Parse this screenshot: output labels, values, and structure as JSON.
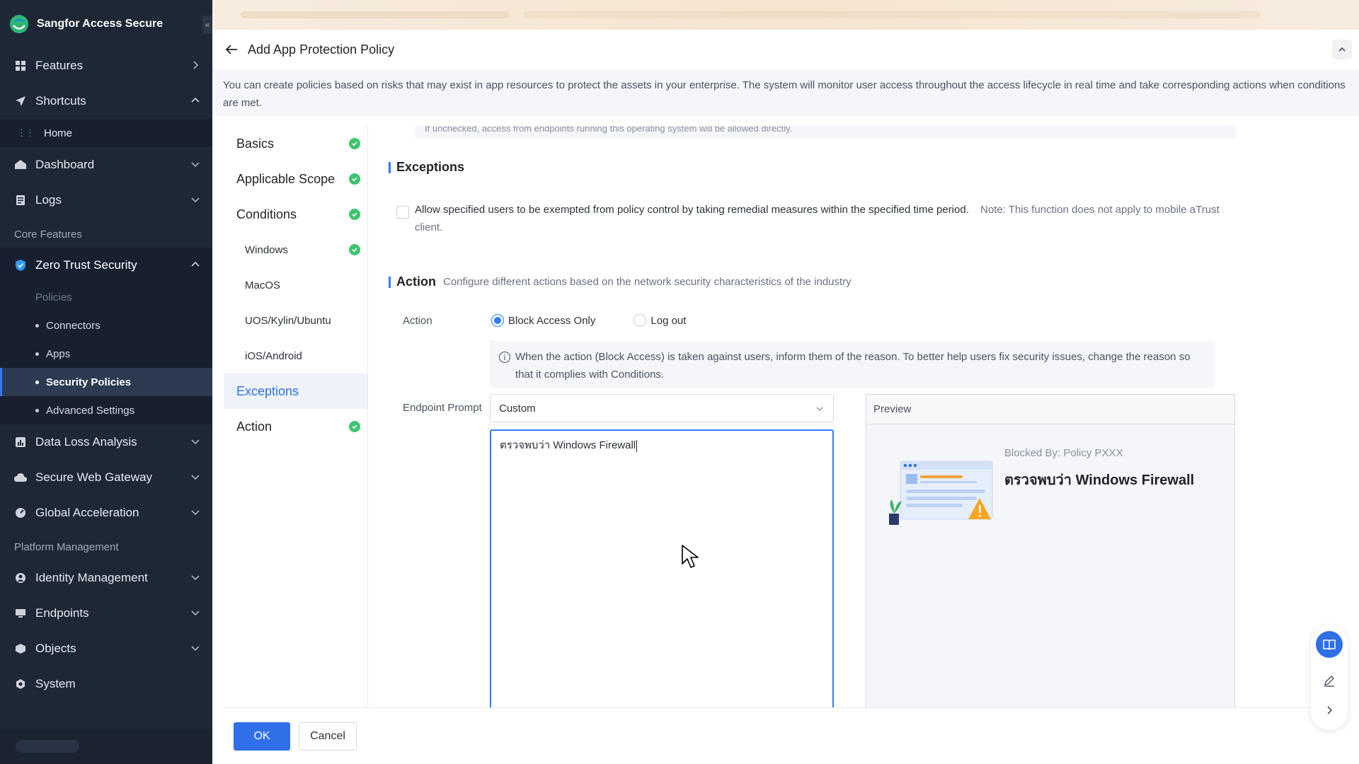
{
  "app": {
    "name": "Sangfor Access Secure"
  },
  "sidebar": {
    "features": "Features",
    "shortcuts": "Shortcuts",
    "home": "Home",
    "dashboard": "Dashboard",
    "logs": "Logs",
    "core_features_label": "Core Features",
    "zero_trust": "Zero Trust Security",
    "policies_label": "Policies",
    "sub_items": [
      "Connectors",
      "Apps",
      "Security Policies",
      "Advanced Settings"
    ],
    "data_loss": "Data Loss Analysis",
    "secure_web": "Secure Web Gateway",
    "global_accel": "Global Acceleration",
    "platform_label": "Platform Management",
    "identity": "Identity Management",
    "endpoints": "Endpoints",
    "objects": "Objects",
    "system": "System"
  },
  "page": {
    "title": "Add App Protection Policy",
    "description": "You can create policies based on risks that may exist in app resources to protect the assets in your enterprise. The system will monitor user access throughout the access lifecycle in real time and take corresponding actions when conditions are met."
  },
  "steps": {
    "basics": "Basics",
    "scope": "Applicable Scope",
    "conditions": "Conditions",
    "windows": "Windows",
    "macos": "MacOS",
    "uos": "UOS/Kylin/Ubuntu",
    "ios": "iOS/Android",
    "exceptions": "Exceptions",
    "action": "Action"
  },
  "form": {
    "truncated_note": "If unchecked, access from endpoints running this operating system will be allowed directly.",
    "exceptions_title": "Exceptions",
    "exceptions_text": "Allow specified users to be exempted from policy control by taking remedial measures within the specified time period.",
    "exceptions_note": "Note: This function does not apply to mobile aTrust client.",
    "action_title": "Action",
    "action_desc": "Configure different actions based on the network security characteristics of the industry",
    "action_label": "Action",
    "radio_block": "Block Access Only",
    "radio_logout": "Log out",
    "info_text": "When the action (Block Access) is taken against users, inform them of the reason. To better help users fix security issues, change the reason so that it complies with Conditions.",
    "endpoint_prompt_label": "Endpoint Prompt",
    "select_value": "Custom",
    "textarea_value": "ตรวจพบว่า Windows Firewall",
    "preview_label": "Preview",
    "preview_blocked": "Blocked By: Policy PXXX",
    "preview_title": "ตรวจพบว่า Windows Firewall"
  },
  "footer": {
    "ok": "OK",
    "cancel": "Cancel"
  }
}
